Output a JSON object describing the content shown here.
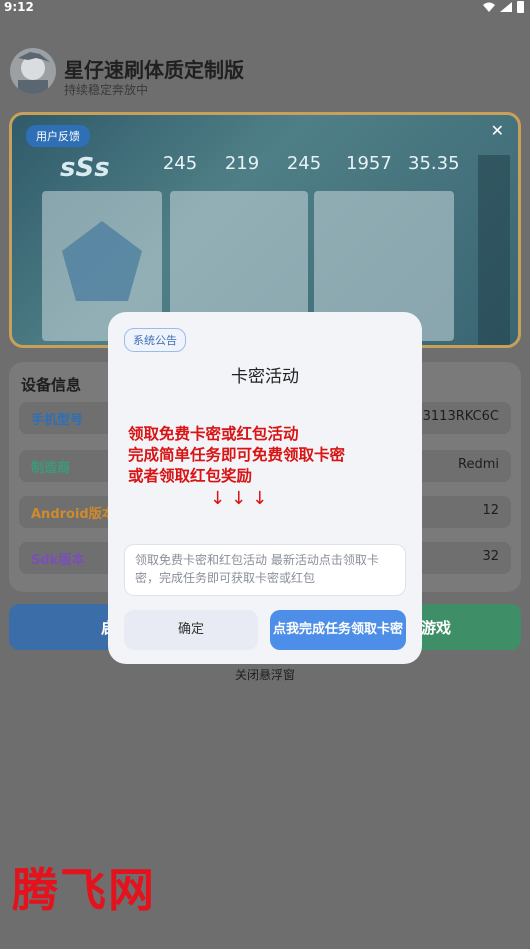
{
  "status_bar": {
    "time": "9:12"
  },
  "header": {
    "title": "星仔速刷体质定制版",
    "subtitle": "持续稳定奔放中"
  },
  "banner": {
    "feedback_label": "用户反馈",
    "rank_text": "sSs",
    "stats": [
      "245",
      "219",
      "245",
      "1957",
      "35.35"
    ]
  },
  "device_info": {
    "title": "设备信息",
    "rows": [
      {
        "label": "手机型号",
        "value": "23113RKC6C",
        "color": "#2f6fb6"
      },
      {
        "label": "制造商",
        "value": "Redmi",
        "color": "#3c9a78"
      },
      {
        "label": "Android版本",
        "value": "12",
        "color": "#d08a2b"
      },
      {
        "label": "Sdk版本",
        "value": "32",
        "color": "#7a4fb8"
      }
    ]
  },
  "bottom": {
    "left_button": "启",
    "right_button": "游戏",
    "close_float": "关闭悬浮窗"
  },
  "dialog": {
    "tag": "系统公告",
    "title": "卡密活动",
    "promo_lines": [
      "领取免费卡密或红包活动",
      "完成简单任务即可免费领取卡密",
      "或者领取红包奖励"
    ],
    "arrows": "↓↓↓",
    "description": "领取免费卡密和红包活动 最新活动点击领取卡密，完成任务即可获取卡密或红包",
    "ok_label": "确定",
    "task_label": "点我完成任务领取卡密"
  },
  "watermark": "腾飞网",
  "colors": {
    "accent": "#4d8fe8",
    "promo": "#d81414",
    "watermark": "#e4121c"
  }
}
